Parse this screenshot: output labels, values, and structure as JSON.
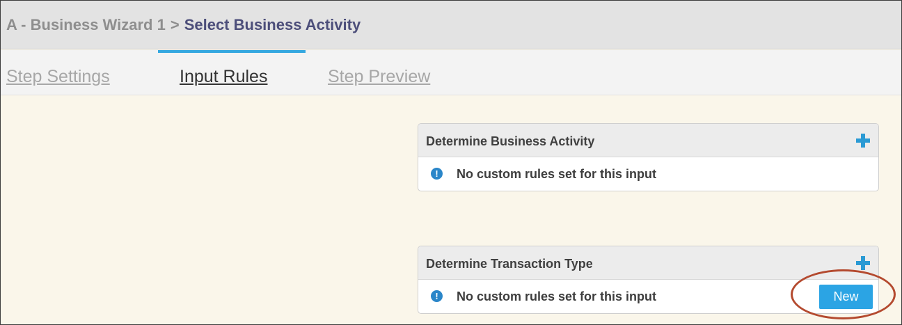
{
  "breadcrumb": {
    "parent": "A - Business Wizard 1",
    "separator": ">",
    "current": "Select Business Activity"
  },
  "tabs": [
    {
      "label": "Step Settings",
      "active": false
    },
    {
      "label": "Input Rules",
      "active": true
    },
    {
      "label": "Step Preview",
      "active": false
    }
  ],
  "panels": [
    {
      "title": "Determine Business Activity",
      "add_icon": "plus-icon",
      "message": "No custom rules set for this input",
      "message_icon": "info-icon"
    },
    {
      "title": "Determine Transaction Type",
      "add_icon": "plus-icon",
      "message": "No custom rules set for this input",
      "message_icon": "info-icon",
      "new_button_label": "New"
    }
  ],
  "colors": {
    "accent": "#35a8e0",
    "button": "#2ba4e4",
    "content_background": "#faf6ea",
    "annotation": "#b44a2f",
    "breadcrumb_current": "#4c4e7a"
  }
}
